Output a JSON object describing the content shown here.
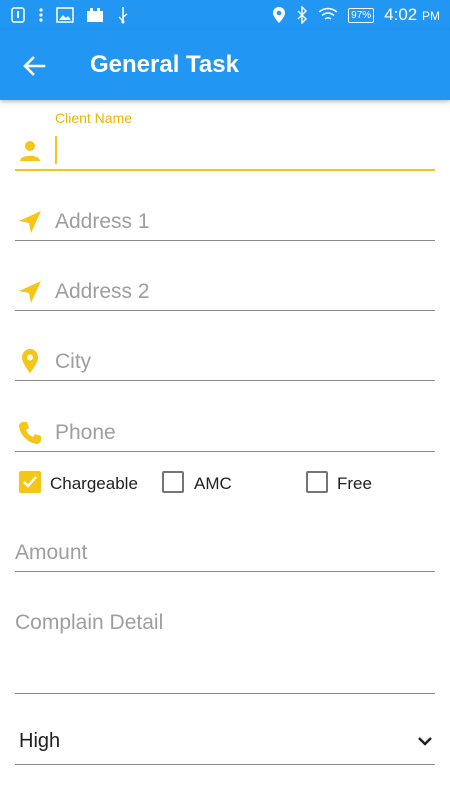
{
  "status_bar": {
    "time": "4:02",
    "time_suffix": "PM",
    "battery": "97%"
  },
  "app_bar": {
    "title": "General Task"
  },
  "form": {
    "client_name_label": "Client Name",
    "client_name_value": "",
    "address1_placeholder": "Address 1",
    "address2_placeholder": "Address 2",
    "city_placeholder": "City",
    "phone_placeholder": "Phone",
    "checkboxes": [
      {
        "label": "Chargeable",
        "checked": true
      },
      {
        "label": "AMC",
        "checked": false
      },
      {
        "label": "Free",
        "checked": false
      }
    ],
    "amount_placeholder": "Amount",
    "complain_placeholder": "Complain Detail",
    "priority_value": "High"
  },
  "colors": {
    "primary": "#2196f3",
    "accent": "#f5c518"
  },
  "icons": {
    "client_name": "person-icon",
    "address1": "navigation-icon",
    "address2": "navigation-icon",
    "city": "location-pin-icon",
    "phone": "phone-icon"
  }
}
